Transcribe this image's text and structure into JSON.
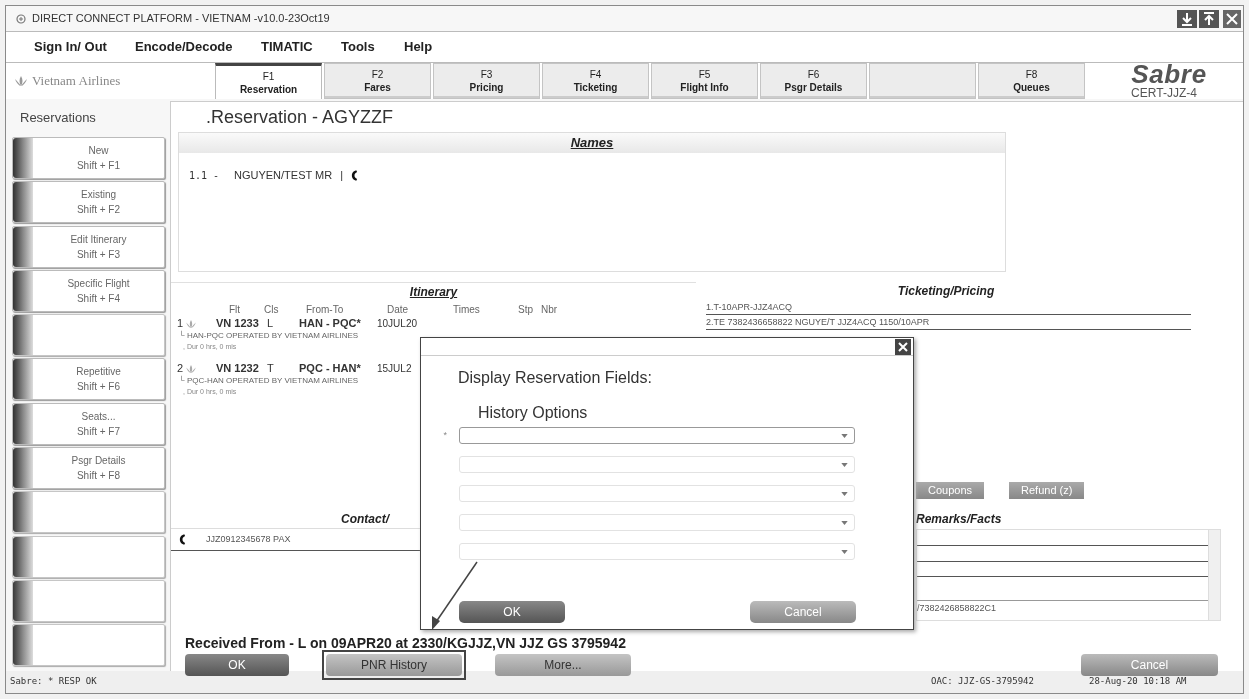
{
  "window": {
    "title": "DIRECT CONNECT PLATFORM - VIETNAM -v10.0-23Oct19"
  },
  "menu": [
    {
      "label": "Sign In/ Out"
    },
    {
      "label": "Encode/Decode"
    },
    {
      "label": "TIMATIC"
    },
    {
      "label": "Tools"
    },
    {
      "label": "Help"
    }
  ],
  "brand": {
    "airline": "Vietnam Airlines",
    "provider": "Sabre",
    "environment": "CERT-JJZ-4"
  },
  "tabs": [
    {
      "key": "F1",
      "label": "Reservation",
      "selected": true
    },
    {
      "key": "F2",
      "label": "Fares",
      "selected": false
    },
    {
      "key": "F3",
      "label": "Pricing",
      "selected": false
    },
    {
      "key": "F4",
      "label": "Ticketing",
      "selected": false
    },
    {
      "key": "F5",
      "label": "Flight Info",
      "selected": false
    },
    {
      "key": "F6",
      "label": "Psgr Details",
      "selected": false
    },
    {
      "selected": false
    },
    {
      "key": "F8",
      "label": "Queues",
      "selected": false
    }
  ],
  "sidebar": {
    "title": "Reservations",
    "items": [
      {
        "kind": "command",
        "label": "New",
        "shortcut": "Shift + F1"
      },
      {
        "kind": "command",
        "label": "Existing",
        "shortcut": "Shift + F2"
      },
      {
        "kind": "command",
        "label": "Edit Itinerary",
        "shortcut": "Shift + F3"
      },
      {
        "kind": "command",
        "label": "Specific Flight",
        "shortcut": "Shift + F4"
      },
      {
        "kind": "blank"
      },
      {
        "kind": "command",
        "label": "Repetitive",
        "shortcut": "Shift + F6"
      },
      {
        "kind": "command",
        "label": "Seats...",
        "shortcut": "Shift + F7"
      },
      {
        "kind": "command",
        "label": "Psgr Details",
        "shortcut": "Shift + F8"
      },
      {
        "kind": "blank"
      },
      {
        "kind": "blank"
      },
      {
        "kind": "blank"
      },
      {
        "kind": "blank"
      }
    ]
  },
  "reservation": {
    "title": ".Reservation - AGYZZF",
    "names": {
      "heading": "Names",
      "entries": [
        {
          "number": "1.1 -",
          "name": "NGUYEN/TEST MR",
          "separator": "|"
        }
      ]
    },
    "itinerary": {
      "heading": "Itinerary",
      "columns": [
        "Flt",
        "Cls",
        "From-To",
        "Date",
        "Times",
        "Stp",
        "Nbr"
      ],
      "segments": [
        {
          "number": "1",
          "flight": "VN 1233",
          "class": "L",
          "route": "HAN - PQC*",
          "date": "10JUL20",
          "operated": "└ HAN-PQC OPERATED BY VIETNAM AIRLINES",
          "duration": ", Dur 0 hrs, 0 mis"
        },
        {
          "number": "2",
          "flight": "VN 1232",
          "class": "T",
          "route": "PQC - HAN*",
          "date": "15JUL2",
          "operated": "└ PQC-HAN OPERATED BY VIETNAM AIRLINES",
          "duration": ", Dur 0 hrs, 0 mis"
        }
      ]
    },
    "ticketing": {
      "heading": "Ticketing/Pricing",
      "lines": [
        "1.T-10APR-JJZ4ACQ",
        "2.TE 7382436658822 NGUYE/T JJZ4ACQ 1150/10APR"
      ],
      "buttons": [
        "Coupons",
        "Refund (z)"
      ]
    },
    "contact": {
      "heading": "Contact/",
      "entries": [
        "JJZ0912345678 PAX"
      ]
    },
    "remarks": {
      "heading": "Remarks/Facts",
      "last_line": "/7382426858822C1"
    },
    "received": "Received From - L on 09APR20 at 2330/KGJJZ,VN JJZ GS 3795942",
    "actions": [
      {
        "label": "OK",
        "kind": "primary",
        "highlighted": false
      },
      {
        "label": "PNR History",
        "kind": "secondary",
        "highlighted": true
      },
      {
        "label": "More...",
        "kind": "secondary",
        "highlighted": false
      },
      {
        "label": "Cancel",
        "kind": "right",
        "highlighted": false
      }
    ]
  },
  "dialog": {
    "title": "Display Reservation Fields:",
    "subtitle": "History Options",
    "fields": [
      {
        "kind": "dropdown",
        "marker": "*"
      },
      {
        "kind": "dropdown"
      },
      {
        "kind": "dropdown"
      },
      {
        "kind": "dropdown"
      },
      {
        "kind": "dropdown"
      }
    ],
    "buttons": [
      "OK",
      "Cancel"
    ]
  },
  "status_bar": {
    "message": "Sabre: * RESP OK",
    "oac": "OAC: JJZ-GS-3795942",
    "time": "28-Aug-20 10:18 AM"
  }
}
